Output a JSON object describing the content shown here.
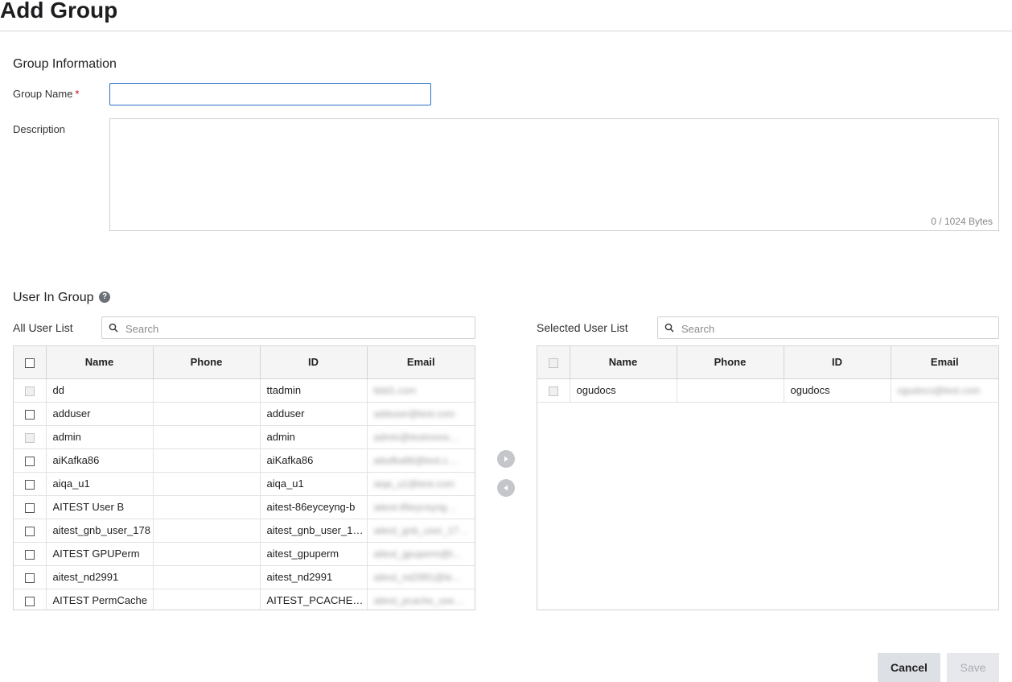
{
  "page": {
    "title": "Add Group"
  },
  "group_info": {
    "title": "Group Information",
    "name_label": "Group Name",
    "required_mark": "*",
    "name_value": "",
    "description_label": "Description",
    "description_value": "",
    "byte_counter": "0 / 1024 Bytes"
  },
  "users": {
    "title": "User In Group",
    "help_icon": "question-circle-icon",
    "all_list": {
      "label": "All User List",
      "search_placeholder": "Search",
      "columns": [
        "Name",
        "Phone",
        "ID",
        "Email"
      ],
      "rows": [
        {
          "name": "dd",
          "phone": "",
          "id": "ttadmin",
          "email": "ttdd1.com",
          "disabled": true
        },
        {
          "name": "adduser",
          "phone": "",
          "id": "adduser",
          "email": "adduser@test.com",
          "disabled": false
        },
        {
          "name": "admin",
          "phone": "",
          "id": "admin",
          "email": "admin@testmono…",
          "disabled": true
        },
        {
          "name": "aiKafka86",
          "phone": "",
          "id": "aiKafka86",
          "email": "aikafka86@test.c…",
          "disabled": false
        },
        {
          "name": "aiqa_u1",
          "phone": "",
          "id": "aiqa_u1",
          "email": "aiqa_u1@test.com",
          "disabled": false
        },
        {
          "name": "AITEST User B",
          "phone": "",
          "id": "aitest-86eyceyng-b",
          "email": "aitest-86eyceyng…",
          "disabled": false
        },
        {
          "name": "aitest_gnb_user_178",
          "phone": "",
          "id": "aitest_gnb_user_1…",
          "email": "aitest_gnb_user_17…",
          "disabled": false
        },
        {
          "name": "AITEST GPUPerm",
          "phone": "",
          "id": "aitest_gpuperm",
          "email": "aitest_gpuperm@t…",
          "disabled": false
        },
        {
          "name": "aitest_nd2991",
          "phone": "",
          "id": "aitest_nd2991",
          "email": "aitest_nd2991@te…",
          "disabled": false
        },
        {
          "name": "AITEST PermCache",
          "phone": "",
          "id": "AITEST_PCACHE_…",
          "email": "aitest_pcache_use…",
          "disabled": false
        }
      ]
    },
    "selected_list": {
      "label": "Selected User List",
      "search_placeholder": "Search",
      "columns": [
        "Name",
        "Phone",
        "ID",
        "Email"
      ],
      "rows": [
        {
          "name": "ogudocs",
          "phone": "",
          "id": "ogudocs",
          "email": "ogudocs@test.com",
          "disabled": true
        }
      ]
    },
    "move_right_icon": "chevron-right-circle-icon",
    "move_left_icon": "chevron-left-circle-icon"
  },
  "actions": {
    "cancel_label": "Cancel",
    "save_label": "Save"
  }
}
